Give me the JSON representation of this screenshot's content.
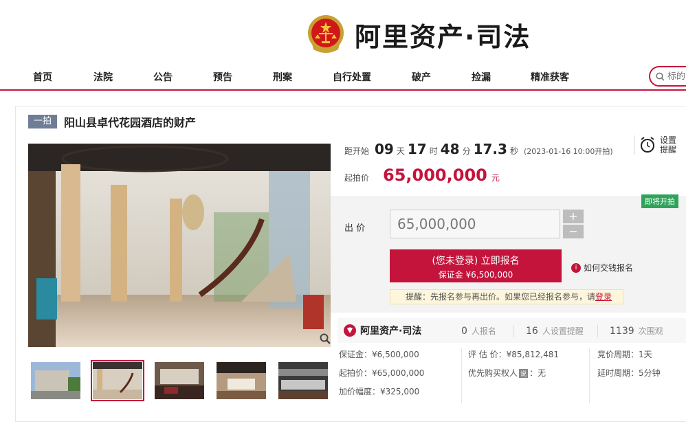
{
  "header": {
    "logo_text": "阿里资产·司法",
    "nav": [
      "首页",
      "法院",
      "公告",
      "预告",
      "刑案",
      "自行处置",
      "破产",
      "捡漏",
      "精准获客"
    ],
    "search_placeholder": "标的"
  },
  "item": {
    "badge": "一拍",
    "title": "阳山县卓代花园酒店的财产"
  },
  "countdown": {
    "label": "距开始",
    "days": "09",
    "days_unit": "天",
    "hours": "17",
    "hours_unit": "时",
    "minutes": "48",
    "minutes_unit": "分",
    "seconds": "17.3",
    "seconds_unit": "秒",
    "note": "(2023-01-16 10:00开拍)"
  },
  "remind": {
    "line1": "设置",
    "line2": "提醒"
  },
  "start_price": {
    "label": "起拍价",
    "value": "65,000,000",
    "unit": "元"
  },
  "bid": {
    "status_tag": "即将开拍",
    "label": "出  价",
    "input_value": "65,000,000",
    "plus": "+",
    "minus": "−",
    "signup_main": "(您未登录) 立即报名",
    "signup_sub": "保证金 ¥6,500,000",
    "howto": "如何交钱报名",
    "hint_prefix": "提醒：先报名参与再出价。如果您已经报名参与，请",
    "hint_login": "登录"
  },
  "stats": {
    "logo_text": "阿里资产·司法",
    "signups": "0",
    "signups_label": "人报名",
    "reminders": "16",
    "reminders_label": "人设置提醒",
    "views": "1139",
    "views_label": "次围观"
  },
  "details": {
    "deposit": "保证金：¥6,500,000",
    "start_price": "起拍价：¥65,000,000",
    "increment": "加价幅度：¥325,000",
    "appraisal": "评 估 价：¥85,812,481",
    "priority_label": "优先购买权人",
    "priority_tag": "说",
    "priority_value": "：无",
    "bid_cycle": "竞价周期：1天",
    "extension": "延时周期：5分钟"
  },
  "colors": {
    "brand_red": "#c4143c",
    "green_tag": "#2fa35a",
    "badge_gray": "#6f7d96"
  }
}
